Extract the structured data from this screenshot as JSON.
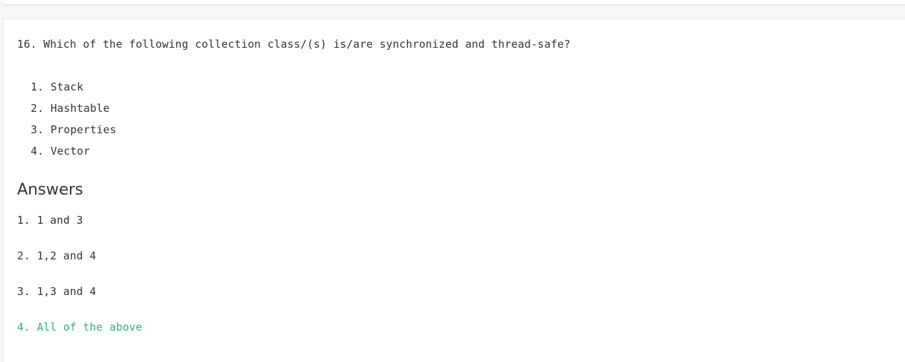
{
  "question": {
    "text": "16. Which of the following collection class/(s) is/are synchronized and thread-safe?",
    "items": [
      "1. Stack",
      "2. Hashtable",
      "3. Properties",
      "4. Vector"
    ]
  },
  "answers": {
    "heading": "Answers",
    "options": [
      "1. 1 and 3",
      "2. 1,2 and 4",
      "3. 1,3 and 4",
      "4. All of the above"
    ],
    "correct_color": "#2bb673"
  }
}
